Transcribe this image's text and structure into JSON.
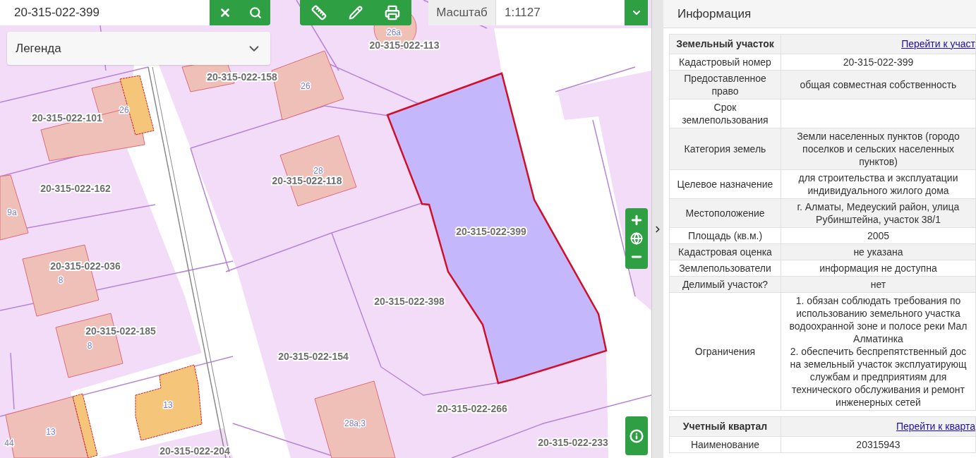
{
  "search": {
    "value": "20-315-022-399"
  },
  "legend": {
    "label": "Легенда",
    "expanded": false
  },
  "scale": {
    "label": "Масштаб",
    "value": "1:1127"
  },
  "map": {
    "parcel_labels": [
      "20-315-022-113",
      "20-315-022-158",
      "20-315-022-101",
      "20-315-022-162",
      "20-315-022-118",
      "20-315-022-399",
      "20-315-022-036",
      "20-315-022-398",
      "20-315-022-185",
      "20-315-022-154",
      "20-315-022-266",
      "20-315-022-204",
      "20-315-022-233"
    ],
    "house_numbers": [
      "26а",
      "26",
      "26",
      "28",
      "9а",
      "8",
      "8",
      "13",
      "13",
      "44",
      "28а,3"
    ]
  },
  "info_panel": {
    "title": "Информация",
    "sections": [
      {
        "title": "Земельный участок",
        "link": "Перейти к участ",
        "rows": [
          {
            "label": "Кадастровый номер",
            "value": "20-315-022-399"
          },
          {
            "label": "Предоставленное право",
            "value": "общая совместная собственность"
          },
          {
            "label": "Срок землепользования",
            "value": ""
          },
          {
            "label": "Категория земель",
            "value": "Земли населенных пунктов (городо\nпоселков и сельских населенных\nпунктов)"
          },
          {
            "label": "Целевое назначение",
            "value": "для строительства и эксплуатации\nиндивидуального жилого дома"
          },
          {
            "label": "Местоположение",
            "value": "г. Алматы, Медеуский район, улица\nРубинштейна, участок 38/1"
          },
          {
            "label": "Площадь (кв.м.)",
            "value": "2005"
          },
          {
            "label": "Кадастровая оценка",
            "value": "не указана"
          },
          {
            "label": "Землепользователи",
            "value": "информация не доступна"
          },
          {
            "label": "Делимый участок?",
            "value": "нет"
          },
          {
            "label": "Ограничения",
            "value": "1. обязан соблюдать требования по\nиспользованию земельного участка\nводоохранной зоне и полосе реки Мал\nАлматинка\n2. обеспечить беспрепятственный дос\nна земельный участок эксплуатирующ\nслужбам и предприятиям для\nтехнического обслуживания и ремонт\nинженерных сетей"
          }
        ]
      },
      {
        "title": "Учетный квартал",
        "link": "Перейти к кварта",
        "rows": [
          {
            "label": "Наименование",
            "value": "20315943"
          }
        ]
      }
    ]
  }
}
